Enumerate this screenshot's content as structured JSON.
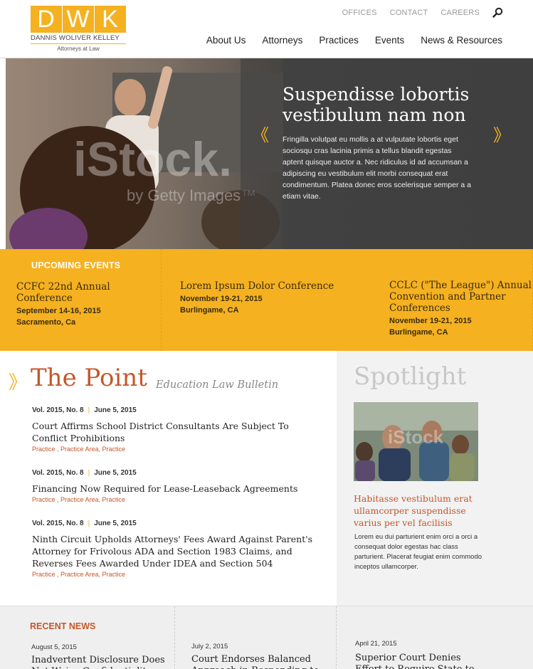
{
  "logo": {
    "letters": [
      "D",
      "W",
      "K"
    ],
    "name": "DANNIS WOLIVER KELLEY",
    "tagline": "Attorneys at Law"
  },
  "util_nav": [
    "OFFICES",
    "CONTACT",
    "CAREERS"
  ],
  "main_nav": [
    "About Us",
    "Attorneys",
    "Practices",
    "Events",
    "News & Resources"
  ],
  "hero": {
    "title": "Suspendisse lobortis vestibulum nam non",
    "text": "Fringilla volutpat eu mollis a at vulputate lobortis eget sociosqu cras lacinia primis a tellus blandit egestas aptent quisque auctor a. Nec ridiculus id ad accumsan a adipiscing eu vestibulum elit morbi consequat erat condimentum. Platea donec eros scelerisque semper a a etiam vitae.",
    "prev": "《",
    "next": "》"
  },
  "events": {
    "heading": "UPCOMING EVENTS",
    "items": [
      {
        "title": "CCFC 22nd Annual Conference",
        "date": "September 14-16, 2015",
        "location": "Sacramento, Ca"
      },
      {
        "title": "Lorem Ipsum Dolor Conference",
        "date": "November 19-21, 2015",
        "location": "Burlingame, CA"
      },
      {
        "title": "CCLC (\"The League\") Annual Convention and Partner Conferences",
        "date": "November 19-21, 2015",
        "location": "Burlingame, CA"
      }
    ]
  },
  "point": {
    "title": "The Point",
    "subtitle": "Education Law Bulletin",
    "articles": [
      {
        "vol": "Vol. 2015, No. 8",
        "date": "June 5, 2015",
        "title": "Court Affirms School District Consultants Are Subject To Conflict Prohibitions",
        "tags": "Practice , Practice Area, Practice"
      },
      {
        "vol": "Vol. 2015, No. 8",
        "date": "June 5, 2015",
        "title": "Financing Now Required for Lease-Leaseback Agreements",
        "tags": "Practice , Practice Area, Practice"
      },
      {
        "vol": "Vol. 2015, No. 8",
        "date": "June 5, 2015",
        "title": "Ninth Circuit Upholds Attorneys' Fees Award Against Parent's Attorney for Frivolous ADA and Section 1983 Claims, and Reverses Fees Awarded Under IDEA and Section 504",
        "tags": "Practice , Practice Area, Practice"
      }
    ]
  },
  "spotlight": {
    "title": "Spotlight",
    "heading": "Habitasse vestibulum erat ullamcorper suspendisse varius per vel facilisis",
    "text": "Lorem eu dui parturient enim orci a orci a consequat dolor egestas hac class parturient. Placerat feugiat enim commodo inceptos ullamcorper."
  },
  "news": {
    "heading": "RECENT NEWS",
    "items": [
      {
        "date": "August 5, 2015",
        "title": "Inadvertent Disclosure Does Not Waive Confidentiality"
      },
      {
        "date": "July 2, 2015",
        "title": "Court Endorses Balanced Approach in Responding to"
      },
      {
        "date": "April 21, 2015",
        "title": "Superior Court Denies Effort to Require State to Intervene in"
      }
    ]
  },
  "colors": {
    "accent": "#f5b120",
    "brand_red": "#c4572b"
  }
}
